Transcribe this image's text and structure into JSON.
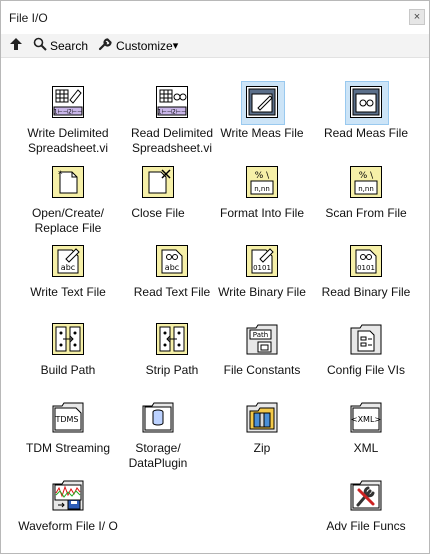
{
  "window": {
    "title": "File I/O",
    "close_glyph": "×"
  },
  "toolbar": {
    "up_icon": "up-arrow-icon",
    "search_label": "Search",
    "customize_label": "Customize",
    "customize_arrow": "▾"
  },
  "palette": {
    "items": [
      {
        "label": "Write Delimited Spreadsheet.vi",
        "icon": "write-delimited-spreadsheet-icon"
      },
      {
        "label": "Read Delimited Spreadsheet.vi",
        "icon": "read-delimited-spreadsheet-icon"
      },
      {
        "label": "Write Meas File",
        "icon": "write-meas-file-icon",
        "selected": true
      },
      {
        "label": "Read Meas File",
        "icon": "read-meas-file-icon",
        "selected": true
      },
      {
        "label": "Open/Create/ Replace File",
        "icon": "open-create-replace-file-icon"
      },
      {
        "label": "Close File",
        "icon": "close-file-icon"
      },
      {
        "label": "Format Into File",
        "icon": "format-into-file-icon"
      },
      {
        "label": "Scan From File",
        "icon": "scan-from-file-icon"
      },
      {
        "label": "Write Text File",
        "icon": "write-text-file-icon"
      },
      {
        "label": "Read Text File",
        "icon": "read-text-file-icon"
      },
      {
        "label": "Write Binary File",
        "icon": "write-binary-file-icon"
      },
      {
        "label": "Read Binary File",
        "icon": "read-binary-file-icon"
      },
      {
        "label": "Build Path",
        "icon": "build-path-icon"
      },
      {
        "label": "Strip Path",
        "icon": "strip-path-icon"
      },
      {
        "label": "File Constants",
        "icon": "file-constants-icon",
        "badge": "Path"
      },
      {
        "label": "Config File VIs",
        "icon": "config-file-vis-icon"
      },
      {
        "label": "TDM Streaming",
        "icon": "tdm-streaming-icon",
        "badge": "TDMS"
      },
      {
        "label": "Storage/ DataPlugin",
        "icon": "storage-dataplugin-icon"
      },
      {
        "label": "Zip",
        "icon": "zip-icon"
      },
      {
        "label": "XML",
        "icon": "xml-icon",
        "badge": "<XML>"
      },
      {
        "label": "Waveform File I/ O",
        "icon": "waveform-file-io-icon"
      },
      {
        "label": "Adv File Funcs",
        "icon": "adv-file-funcs-icon"
      }
    ]
  },
  "icon_text": {
    "delim": "1⊢⊣2⊢⊣",
    "abc": "abc",
    "binary": "0101",
    "format_codes": "% \\ n,nn"
  },
  "colors": {
    "icon_yellow": "#f6f0a8",
    "selection_fill": "#cce4f7",
    "selection_border": "#99c9ef",
    "folder_tab": "#e8e8e8"
  }
}
